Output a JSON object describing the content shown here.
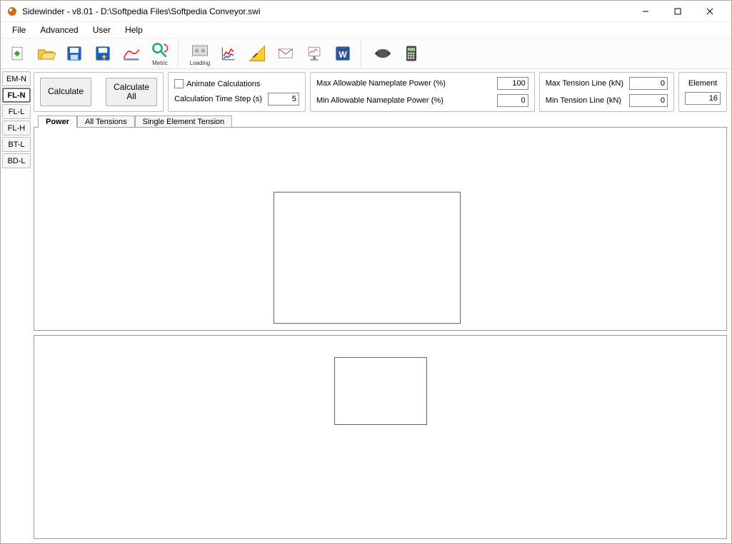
{
  "window": {
    "title": "Sidewinder - v8.01 - D:\\Softpedia Files\\Softpedia Conveyor.swi"
  },
  "menubar": [
    "File",
    "Advanced",
    "User",
    "Help"
  ],
  "toolbar": [
    {
      "name": "new-icon"
    },
    {
      "name": "open-icon"
    },
    {
      "name": "save-icon"
    },
    {
      "name": "export-icon"
    },
    {
      "name": "model-icon"
    },
    {
      "name": "metric-icon",
      "cap": "Metric"
    },
    {
      "sep": true
    },
    {
      "name": "loading-icon",
      "cap": "Loading"
    },
    {
      "name": "graph-icon"
    },
    {
      "name": "gauge-icon"
    },
    {
      "name": "mail-icon"
    },
    {
      "name": "chart-icon"
    },
    {
      "name": "word-icon"
    },
    {
      "sep": true
    },
    {
      "name": "motor-icon"
    },
    {
      "name": "calc-icon"
    }
  ],
  "sidetabs": {
    "items": [
      "EM-N",
      "FL-N",
      "FL-L",
      "FL-H",
      "BT-L",
      "BD-L"
    ],
    "active": 1
  },
  "controls": {
    "calculate": "Calculate",
    "calculate_all": "Calculate\nAll",
    "animate_label": "Animate Calculations",
    "timestep_label": "Calculation Time Step (s)",
    "timestep_value": "5",
    "max_power_label": "Max Allowable Nameplate Power (%)",
    "max_power_value": "100",
    "min_power_label": "Min Allowable Nameplate Power (%)",
    "min_power_value": "0",
    "max_tension_label": "Max Tension Line (kN)",
    "max_tension_value": "0",
    "min_tension_label": "Min Tension Line (kN)",
    "min_tension_value": "0",
    "element_label": "Element",
    "element_value": "16"
  },
  "result_tabs": {
    "items": [
      "Power",
      "All Tensions",
      "Single Element Tension"
    ],
    "active": 0
  }
}
